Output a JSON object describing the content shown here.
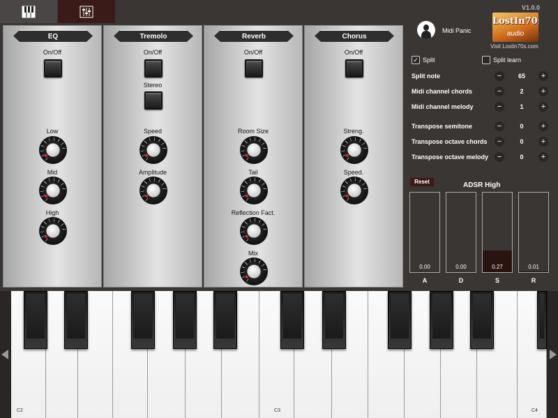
{
  "tabs": [
    {
      "icon": "piano-icon"
    },
    {
      "icon": "mixer-sliders-icon"
    }
  ],
  "panels": {
    "eq": {
      "title": "EQ",
      "onoff_label": "On/Off",
      "knobs": [
        "Low",
        "Mid",
        "High"
      ]
    },
    "tremolo": {
      "title": "Tremolo",
      "onoff_label": "On/Off",
      "stereo_label": "Stereo",
      "knobs": [
        "Speed",
        "Amplitude"
      ]
    },
    "reverb": {
      "title": "Reverb",
      "onoff_label": "On/Off",
      "knobs": [
        "Room Size",
        "Tail",
        "Reflection Fact.",
        "Mix"
      ]
    },
    "chorus": {
      "title": "Chorus",
      "onoff_label": "On/Off",
      "knobs": [
        "Streng.",
        "Speed."
      ]
    }
  },
  "knob_scale": [
    "0",
    "1",
    "2",
    "3",
    "4",
    "5",
    "6",
    "7",
    "8",
    "9",
    "10"
  ],
  "right": {
    "version": "V1.0.0",
    "midi_panic_label": "Midi Panic",
    "logo_line1": "LostIn70s",
    "logo_line2": "audio",
    "visit_label": "Visit Lostin70s.com",
    "split": {
      "label": "Split",
      "checked": true,
      "mark": "✓"
    },
    "split_learn": {
      "label": "Split learn",
      "checked": false
    },
    "rows": [
      {
        "label": "Split note",
        "value": "65"
      },
      {
        "label": "Midi channel chords",
        "value": "2"
      },
      {
        "label": "Midi channel melody",
        "value": "1"
      },
      {
        "label": "Transpose semitone",
        "value": "0"
      },
      {
        "label": "Transpose octave chords",
        "value": "0"
      },
      {
        "label": "Transpose octave melody",
        "value": "0"
      }
    ],
    "minus": "−",
    "plus": "+",
    "reset_label": "Reset",
    "adsr_title": "ADSR High",
    "adsr": [
      {
        "label": "A",
        "value": "0.00",
        "level": 0.0
      },
      {
        "label": "D",
        "value": "0.00",
        "level": 0.0
      },
      {
        "label": "S",
        "value": "0.27",
        "level": 0.27
      },
      {
        "label": "R",
        "value": "0.01",
        "level": 0.01
      }
    ]
  },
  "keyboard": {
    "notes": [
      "C2",
      "C3",
      "C4"
    ]
  }
}
